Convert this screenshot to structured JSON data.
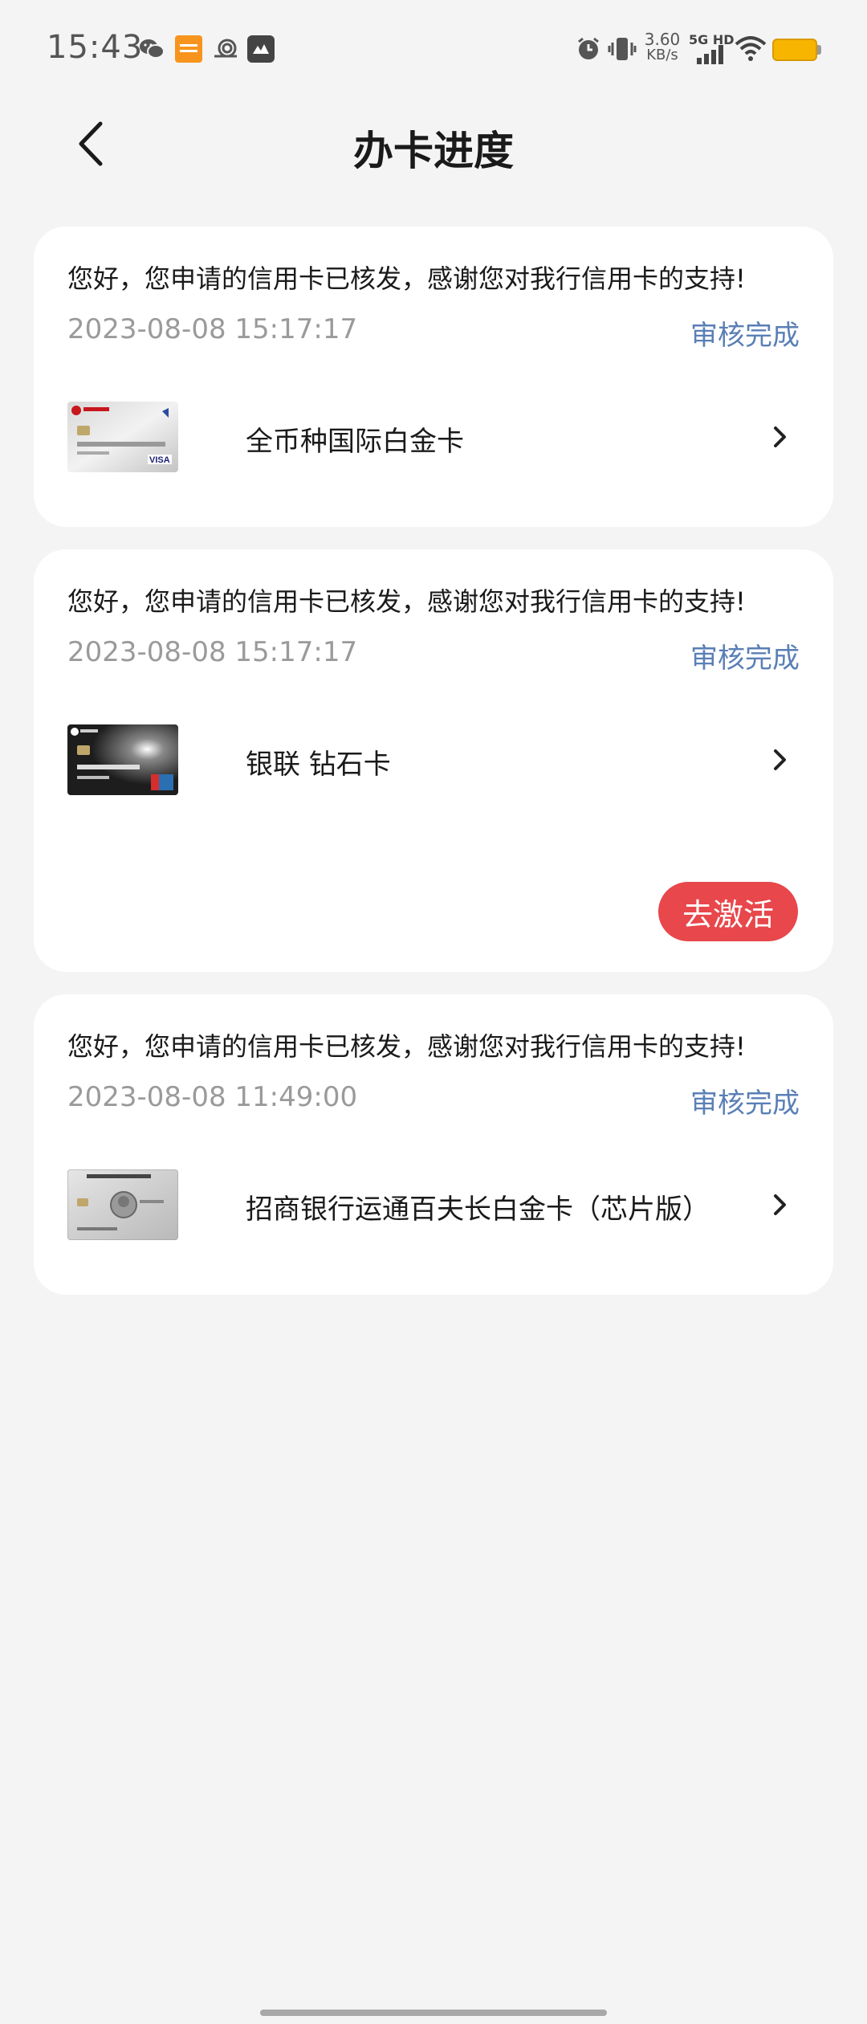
{
  "status_bar": {
    "time": "15:43",
    "speed_value": "3.60",
    "speed_unit": "KB/s",
    "network": "5G HD",
    "left_icons": [
      "wechat-icon",
      "taobao-icon",
      "snail-icon",
      "mail-app-icon"
    ],
    "right_icons": [
      "alarm-icon",
      "vibrate-icon",
      "signal-icon",
      "wifi-icon",
      "battery-icon"
    ]
  },
  "header": {
    "title": "办卡进度",
    "back_icon": "chevron-left-icon"
  },
  "cards": [
    {
      "message": "您好，您申请的信用卡已核发，感谢您对我行信用卡的支持!",
      "date": "2023-08-08 15:17:17",
      "status": "审核完成",
      "card_name": "全币种国际白金卡",
      "thumb": "silver-visa-card"
    },
    {
      "message": "您好，您申请的信用卡已核发，感谢您对我行信用卡的支持!",
      "date": "2023-08-08 15:17:17",
      "status": "审核完成",
      "card_name": "银联 钻石卡",
      "thumb": "black-diamond-card",
      "action_label": "去激活"
    },
    {
      "message": "您好，您申请的信用卡已核发，感谢您对我行信用卡的支持!",
      "date": "2023-08-08 11:49:00",
      "status": "审核完成",
      "card_name": "招商银行运通百夫长白金卡（芯片版）",
      "thumb": "amex-platinum-card"
    }
  ],
  "colors": {
    "background": "#f4f4f4",
    "status_blue": "#5a7fb6",
    "activate_red": "#e8474b",
    "date_gray": "#9a9a9a"
  }
}
